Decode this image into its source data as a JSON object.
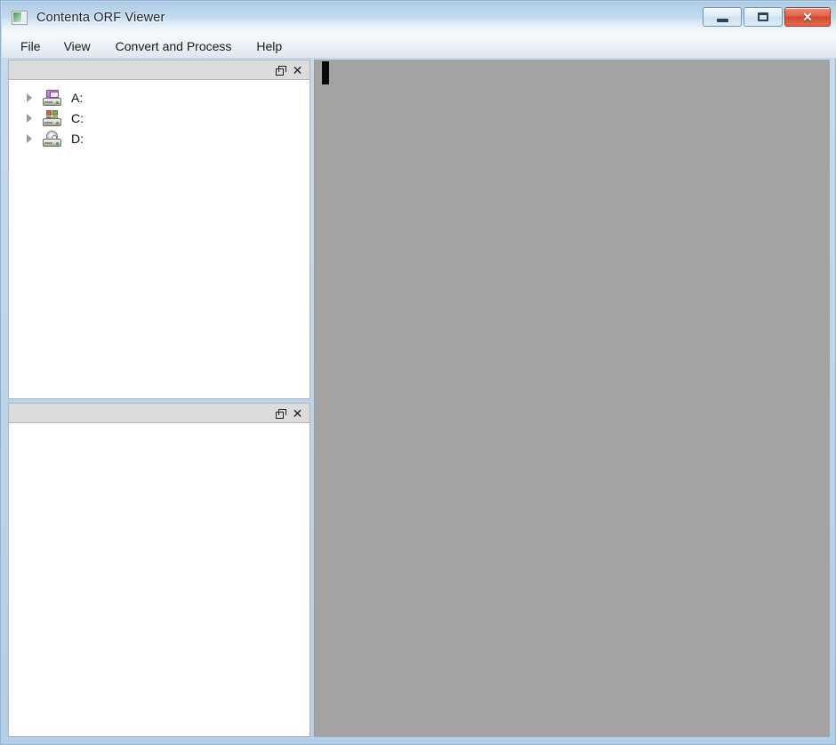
{
  "window": {
    "title": "Contenta ORF Viewer",
    "icon": "app-thumbnail-icon",
    "controls": {
      "minimize_label": "–",
      "maximize_label": "❐",
      "close_label": "✕"
    }
  },
  "menubar": {
    "items": [
      {
        "label": "File",
        "name": "menu-file"
      },
      {
        "label": "View",
        "name": "menu-view"
      },
      {
        "label": "Convert and Process",
        "name": "menu-convert"
      },
      {
        "label": "Help",
        "name": "menu-help"
      }
    ]
  },
  "panels": {
    "browser": {
      "title": "",
      "float_icon": "float-panel-icon",
      "close_icon": "close-panel-icon",
      "tree": [
        {
          "label": "A:",
          "icon": "floppy-drive-icon",
          "expanded": false
        },
        {
          "label": "C:",
          "icon": "windows-hard-drive-icon",
          "expanded": false
        },
        {
          "label": "D:",
          "icon": "cd-drive-icon",
          "expanded": false
        }
      ]
    },
    "preview": {
      "title": "",
      "float_icon": "float-panel-icon",
      "close_icon": "close-panel-icon",
      "content": ""
    }
  },
  "viewer": {
    "content": "",
    "background_color": "#a3a3a3"
  },
  "colors": {
    "titlebar_blue": "#b6d2e9",
    "close_button_red": "#cf4a2e",
    "panel_header_gray": "#dcdcdc",
    "viewer_gray": "#a3a3a3",
    "frame_blue": "#b9d4ea"
  }
}
